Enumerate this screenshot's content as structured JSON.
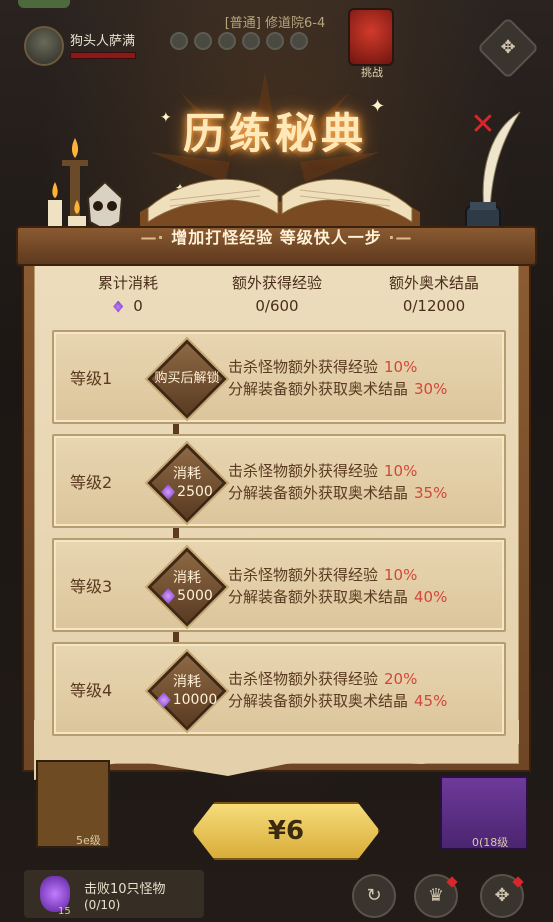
{
  "top": {
    "player_name": "狗头人萨满",
    "stage_title": "[普通] 修道院6-4",
    "boss_label": "挑战"
  },
  "dialog": {
    "title": "历练秘典",
    "subtitle": "增加打怪经验 等级快人一步",
    "subtitle_deco_left": "—·",
    "subtitle_deco_right": "·—"
  },
  "stats": {
    "consumed_label": "累计消耗",
    "consumed_value": "0",
    "exp_label": "额外获得经验",
    "exp_value": "0/600",
    "crystal_label": "额外奥术结晶",
    "crystal_value": "0/12000"
  },
  "levels": [
    {
      "name": "等级1",
      "locked_text": "购买后解锁",
      "line1": "击杀怪物额外获得经验",
      "pct1": "10%",
      "line2": "分解装备额外获取奥术结晶",
      "pct2": "30%"
    },
    {
      "name": "等级2",
      "cost_label": "消耗",
      "cost_value": "2500",
      "line1": "击杀怪物额外获得经验",
      "pct1": "10%",
      "line2": "分解装备额外获取奥术结晶",
      "pct2": "35%"
    },
    {
      "name": "等级3",
      "cost_label": "消耗",
      "cost_value": "5000",
      "line1": "击杀怪物额外获得经验",
      "pct1": "10%",
      "line2": "分解装备额外获取奥术结晶",
      "pct2": "40%"
    },
    {
      "name": "等级4",
      "cost_label": "消耗",
      "cost_value": "10000",
      "line1": "击杀怪物额外获得经验",
      "pct1": "20%",
      "line2": "分解装备额外获取奥术结晶",
      "pct2": "45%"
    }
  ],
  "buy_button": {
    "label": "¥6"
  },
  "bottom": {
    "left_card_level": "5e级",
    "right_card_count": "0(18级",
    "quest_text": "击败10只怪物",
    "quest_progress": "(0/10)",
    "quest_num": "15"
  },
  "colors": {
    "accent_red": "#d2483a",
    "panel_brown": "#8b5c33",
    "parchment": "#ecdcbc",
    "button_gold": "#f6dc7a"
  },
  "icons": {
    "close": "close-icon",
    "crystal": "crystal-icon",
    "settings": "settings-icon"
  }
}
